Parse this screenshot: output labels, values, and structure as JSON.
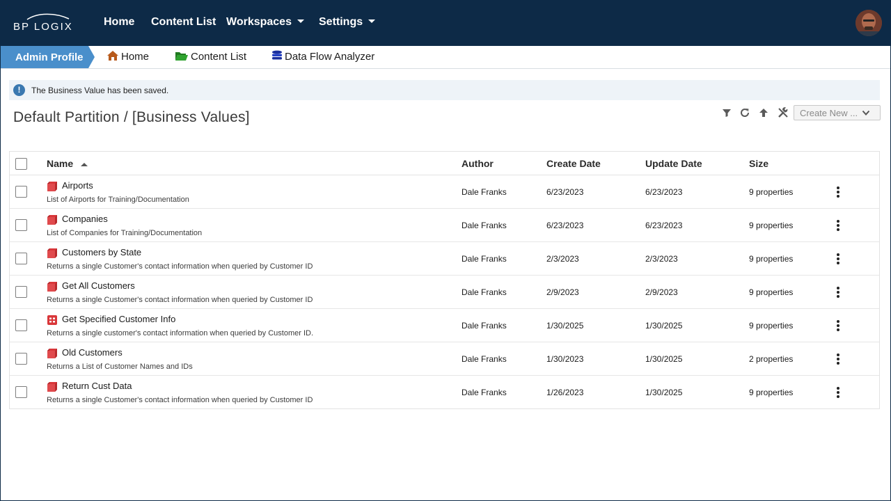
{
  "brand": {
    "logo_text": "BP LOGIX"
  },
  "topnav": {
    "items": [
      {
        "label": "Home",
        "has_dropdown": false
      },
      {
        "label": "Content List",
        "has_dropdown": false
      },
      {
        "label": "Workspaces",
        "has_dropdown": true
      },
      {
        "label": "Settings",
        "has_dropdown": true
      }
    ]
  },
  "breadcrumbs": {
    "admin": "Admin Profile",
    "items": [
      {
        "label": "Home",
        "icon": "home-icon"
      },
      {
        "label": "Content List",
        "icon": "folder-icon"
      },
      {
        "label": "Data Flow Analyzer",
        "icon": "database-icon"
      }
    ]
  },
  "message": {
    "icon": "info-icon",
    "text": "The Business Value has been saved."
  },
  "page": {
    "title": "Default Partition / [Business Values]"
  },
  "toolbar": {
    "icons": [
      "filter-icon",
      "refresh-icon",
      "up-arrow-icon",
      "tools-icon"
    ],
    "create_label": "Create New ..."
  },
  "table": {
    "columns": {
      "name": "Name",
      "author": "Author",
      "create_date": "Create Date",
      "update_date": "Update Date",
      "size": "Size"
    },
    "sort": "name-ascending",
    "rows": [
      {
        "icon": "business-value-icon",
        "name": "Airports",
        "desc": "List of Airports for Training/Documentation",
        "author": "Dale Franks",
        "create_date": "6/23/2023",
        "update_date": "6/23/2023",
        "size": "9 properties"
      },
      {
        "icon": "business-value-icon",
        "name": "Companies",
        "desc": "List of Companies for Training/Documentation",
        "author": "Dale Franks",
        "create_date": "6/23/2023",
        "update_date": "6/23/2023",
        "size": "9 properties"
      },
      {
        "icon": "business-value-icon",
        "name": "Customers by State",
        "desc": "Returns a single Customer's contact information when queried by Customer ID",
        "author": "Dale Franks",
        "create_date": "2/3/2023",
        "update_date": "2/3/2023",
        "size": "9 properties"
      },
      {
        "icon": "business-value-icon",
        "name": "Get All Customers",
        "desc": "Returns a single Customer's contact information when queried by Customer ID",
        "author": "Dale Franks",
        "create_date": "2/9/2023",
        "update_date": "2/9/2023",
        "size": "9 properties"
      },
      {
        "icon": "form-icon",
        "name": "Get Specified Customer Info",
        "desc": "Returns a single customer's contact information when queried by Customer ID.",
        "author": "Dale Franks",
        "create_date": "1/30/2025",
        "update_date": "1/30/2025",
        "size": "9 properties"
      },
      {
        "icon": "business-value-icon",
        "name": "Old Customers",
        "desc": "Returns a List of Customer Names and IDs",
        "author": "Dale Franks",
        "create_date": "1/30/2023",
        "update_date": "1/30/2025",
        "size": "2 properties"
      },
      {
        "icon": "business-value-icon",
        "name": "Return Cust Data",
        "desc": "Returns a single Customer's contact information when queried by Customer ID",
        "author": "Dale Franks",
        "create_date": "1/26/2023",
        "update_date": "1/30/2025",
        "size": "9 properties"
      }
    ]
  },
  "colors": {
    "nav_bg": "#0d2a47",
    "admin_tab": "#4a8fcb",
    "row_icon": "#d9373a",
    "info": "#3a78b0"
  }
}
